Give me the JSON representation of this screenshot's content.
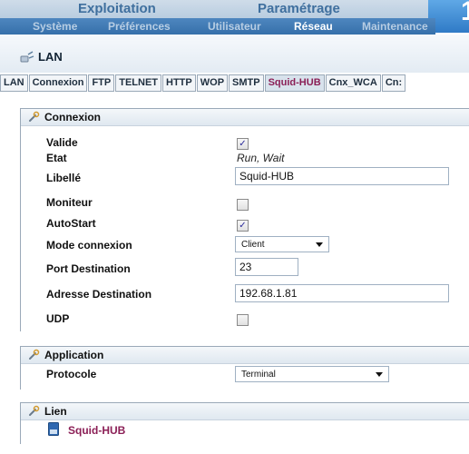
{
  "header": {
    "top_tabs": [
      "Exploitation",
      "Paramétrage"
    ],
    "badge_digit": "1",
    "sub_tabs": [
      "Système",
      "Préférences",
      "Utilisateur",
      "Réseau",
      "Maintenance"
    ],
    "active_sub_tab": "Réseau"
  },
  "page": {
    "title": "LAN"
  },
  "protocol_tabs": {
    "items": [
      "LAN",
      "Connexion",
      "FTP",
      "TELNET",
      "HTTP",
      "WOP",
      "SMTP",
      "Squid-HUB",
      "Cnx_WCA",
      "Cn:"
    ],
    "active": "Squid-HUB"
  },
  "sections": {
    "connexion": {
      "title": "Connexion",
      "fields": {
        "valide": {
          "label": "Valide",
          "checked": true
        },
        "etat": {
          "label": "Etat",
          "value": "Run, Wait"
        },
        "libelle": {
          "label": "Libellé",
          "value": "Squid-HUB"
        },
        "moniteur": {
          "label": "Moniteur",
          "checked": false
        },
        "autostart": {
          "label": "AutoStart",
          "checked": true
        },
        "mode_connexion": {
          "label": "Mode connexion",
          "value": "Client"
        },
        "port_destination": {
          "label": "Port Destination",
          "value": "23"
        },
        "adresse_destination": {
          "label": "Adresse Destination",
          "value": "192.68.1.81"
        },
        "udp": {
          "label": "UDP",
          "checked": false
        }
      }
    },
    "application": {
      "title": "Application",
      "fields": {
        "protocole": {
          "label": "Protocole",
          "value": "Terminal"
        }
      }
    },
    "lien": {
      "title": "Lien",
      "link_label": "Squid-HUB"
    }
  },
  "colors": {
    "primary": "#3f6f9e",
    "active_link": "#8b1f56",
    "sub_bar": "#3670aa"
  }
}
